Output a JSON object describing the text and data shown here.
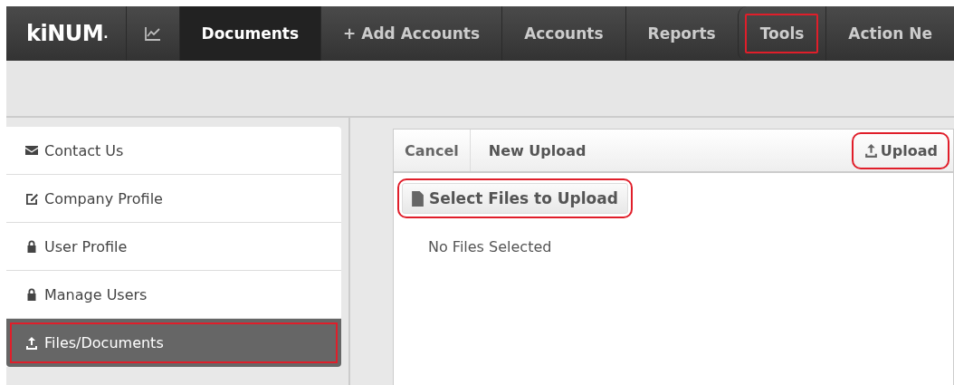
{
  "logo": {
    "text": "kiNUM",
    "dot": "."
  },
  "nav": [
    {
      "kind": "icon",
      "selected": false,
      "annotated": false
    },
    {
      "kind": "text",
      "label": "Documents",
      "selected": true,
      "annotated": false
    },
    {
      "kind": "text",
      "label": "+ Add Accounts",
      "selected": false,
      "annotated": false
    },
    {
      "kind": "text",
      "label": "Accounts",
      "selected": false,
      "annotated": false
    },
    {
      "kind": "text",
      "label": "Reports",
      "selected": false,
      "annotated": false
    },
    {
      "kind": "text",
      "label": "Tools",
      "selected": false,
      "annotated": true
    },
    {
      "kind": "text",
      "label": "Action Ne",
      "selected": false,
      "annotated": false
    }
  ],
  "sidebar": {
    "items": [
      {
        "kind": "mail",
        "label": "Contact Us",
        "selected": false,
        "annotated": false
      },
      {
        "kind": "edit",
        "label": "Company Profile",
        "selected": false,
        "annotated": false
      },
      {
        "kind": "lock",
        "label": "User Profile",
        "selected": false,
        "annotated": false
      },
      {
        "kind": "lock",
        "label": "Manage Users",
        "selected": false,
        "annotated": false
      },
      {
        "kind": "upload",
        "label": "Files/Documents",
        "selected": true,
        "annotated": true
      }
    ]
  },
  "upload_panel": {
    "cancel": "Cancel",
    "title": "New Upload",
    "upload_button": {
      "label": "Upload",
      "annotated": true
    },
    "select_button": {
      "label": "Select Files to Upload",
      "annotated": true
    },
    "status": "No Files Selected"
  }
}
